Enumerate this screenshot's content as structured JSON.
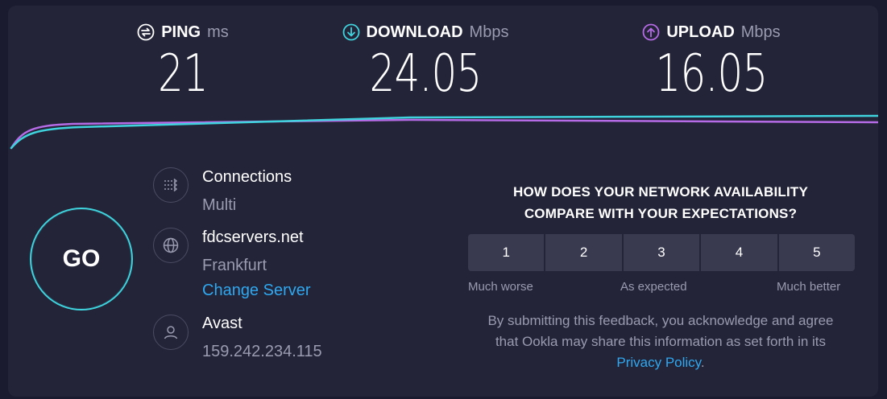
{
  "metrics": {
    "ping": {
      "label": "PING",
      "unit": "ms",
      "value": "21",
      "icon": "ping-icon",
      "color": "#ffffff"
    },
    "download": {
      "label": "DOWNLOAD",
      "unit": "Mbps",
      "value": "24.05",
      "icon": "download-arrow-icon",
      "color": "#3fd3dd"
    },
    "upload": {
      "label": "UPLOAD",
      "unit": "Mbps",
      "value": "16.05",
      "icon": "upload-arrow-icon",
      "color": "#b66be6"
    }
  },
  "go_button": {
    "label": "GO",
    "color": "#3fd3dd"
  },
  "connections": {
    "title": "Connections",
    "value": "Multi",
    "icon": "connections-icon"
  },
  "server": {
    "host": "fdcservers.net",
    "location": "Frankfurt",
    "change_label": "Change Server",
    "icon": "globe-icon"
  },
  "provider": {
    "name": "Avast",
    "ip": "159.242.234.115",
    "icon": "user-icon"
  },
  "survey": {
    "question_line1": "HOW DOES YOUR NETWORK AVAILABILITY",
    "question_line2": "COMPARE WITH YOUR EXPECTATIONS?",
    "options": [
      "1",
      "2",
      "3",
      "4",
      "5"
    ],
    "scale_low": "Much worse",
    "scale_mid": "As expected",
    "scale_high": "Much better",
    "disclaimer": "By submitting this feedback, you acknowledge and agree that Ookla may share this information as set forth in its",
    "privacy_link": "Privacy Policy",
    "period": "."
  },
  "colors": {
    "accent_link": "#2fa8f0",
    "background": "#232438"
  }
}
